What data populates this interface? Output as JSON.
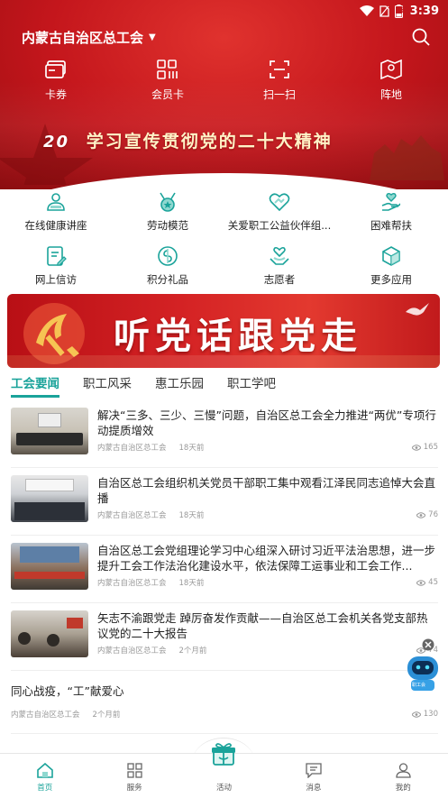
{
  "status": {
    "time": "3:39",
    "battery": "6"
  },
  "header": {
    "region": "内蒙古自治区总工会",
    "colors": {
      "red": "#c4161c",
      "accent": "#1aa39a"
    }
  },
  "quick_actions": [
    {
      "label": "卡券",
      "icon": "card-icon"
    },
    {
      "label": "会员卡",
      "icon": "member-card-icon"
    },
    {
      "label": "扫一扫",
      "icon": "scan-icon"
    },
    {
      "label": "阵地",
      "icon": "map-icon"
    }
  ],
  "banner1": {
    "year": "20",
    "text": "学习宣传贯彻党的二十大精神"
  },
  "services": [
    {
      "label": "在线健康讲座",
      "icon": "health-lecture-icon"
    },
    {
      "label": "劳动模范",
      "icon": "model-worker-icon"
    },
    {
      "label": "关爱职工公益伙伴组...",
      "icon": "care-heart-icon"
    },
    {
      "label": "困难帮扶",
      "icon": "help-hand-icon"
    },
    {
      "label": "网上信访",
      "icon": "petition-icon"
    },
    {
      "label": "积分礼品",
      "icon": "points-gift-icon"
    },
    {
      "label": "志愿者",
      "icon": "volunteer-icon"
    },
    {
      "label": "更多应用",
      "icon": "more-apps-icon"
    }
  ],
  "banner2": {
    "text": "听党话跟党走"
  },
  "tabs": [
    "工会要闻",
    "职工风采",
    "惠工乐园",
    "职工学吧"
  ],
  "news": [
    {
      "title": "解决“三多、三少、三慢”问题，自治区总工会全力推进“两优”专项行动提质增效",
      "source": "内蒙古自治区总工会",
      "time": "18天前",
      "views": "165"
    },
    {
      "title": "自治区总工会组织机关党员干部职工集中观看江泽民同志追悼大会直播",
      "source": "内蒙古自治区总工会",
      "time": "18天前",
      "views": "76"
    },
    {
      "title": "自治区总工会党组理论学习中心组深入研讨习近平法治思想，进一步提升工会工作法治化建设水平，依法保障工运事业和工会工作...",
      "source": "内蒙古自治区总工会",
      "time": "18天前",
      "views": "45"
    },
    {
      "title": "矢志不渝跟党走 踔厉奋发作贡献——自治区总工会机关各党支部热议党的二十大报告",
      "source": "内蒙古自治区总工会",
      "time": "2个月前",
      "views": "74"
    },
    {
      "title": "同心战疫，“工”献爱心",
      "source": "内蒙古自治区总工会",
      "time": "2个月前",
      "views": "130"
    }
  ],
  "robot": {
    "label": "职工会"
  },
  "bottom_nav": [
    {
      "label": "首页",
      "icon": "home-icon"
    },
    {
      "label": "服务",
      "icon": "services-grid-icon"
    },
    {
      "label": "活动",
      "icon": "gift-icon"
    },
    {
      "label": "消息",
      "icon": "message-icon"
    },
    {
      "label": "我的",
      "icon": "profile-icon"
    }
  ]
}
